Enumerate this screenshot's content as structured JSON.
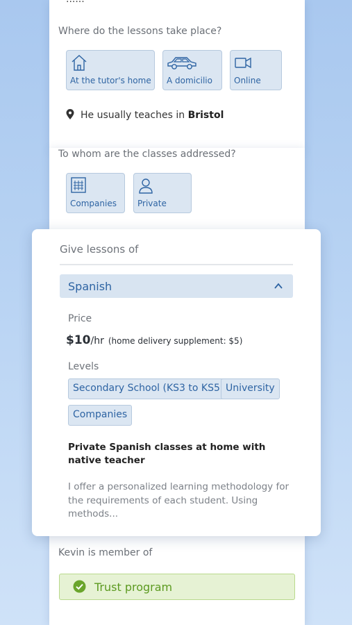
{
  "top_section": {
    "cut_title": "......",
    "location_question": "Where do the lessons take place?",
    "location_options": [
      {
        "label": "At the tutor's home",
        "icon": "house-icon"
      },
      {
        "label": "A domicilio",
        "icon": "car-icon"
      },
      {
        "label": "Online",
        "icon": "video-camera-icon"
      }
    ],
    "teaches_in_prefix": "He usually teaches in",
    "teaches_in_city": "Bristol"
  },
  "audience": {
    "question": "To whom are the classes addressed?",
    "options": [
      {
        "label": "Companies",
        "icon": "building-icon"
      },
      {
        "label": "Private",
        "icon": "person-icon"
      }
    ]
  },
  "lessons_card": {
    "heading": "Give lessons of",
    "subject": "Spanish",
    "price_label": "Price",
    "price_amount": "$10",
    "price_unit": "/hr",
    "price_supplement": "(home delivery supplement: $5)",
    "levels_label": "Levels",
    "levels": [
      "Secondary School (KS3 to KS5)",
      "University",
      "Companies"
    ],
    "description_title": "Private Spanish classes at home with native teacher",
    "description_text": "I offer a personalized learning methodology for the requirements of each student. Using methods..."
  },
  "membership": {
    "label": "Kevin is member of",
    "program": "Trust program"
  },
  "colors": {
    "accent_blue": "#2e64a3",
    "chip_bg": "#dbe6f2",
    "trust_green": "#5c9a20",
    "trust_bg": "#e6f2d4"
  }
}
